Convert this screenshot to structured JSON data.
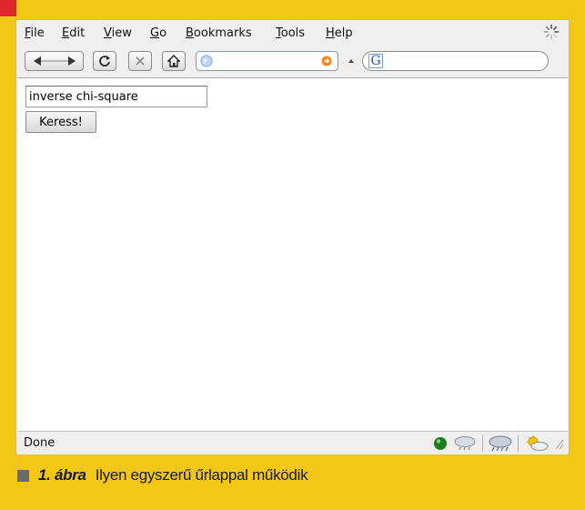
{
  "menubar": {
    "items": [
      {
        "label": "File",
        "mnemonic": "F",
        "rest": "ile"
      },
      {
        "label": "Edit",
        "mnemonic": "E",
        "rest": "dit"
      },
      {
        "label": "View",
        "mnemonic": "V",
        "rest": "iew"
      },
      {
        "label": "Go",
        "mnemonic": "G",
        "rest": "o"
      },
      {
        "label": "Bookmarks",
        "mnemonic": "B",
        "rest": "ookmarks"
      },
      {
        "label": "Tools",
        "mnemonic": "T",
        "rest": "ools"
      },
      {
        "label": "Help",
        "mnemonic": "H",
        "rest": "elp"
      }
    ]
  },
  "toolbar": {
    "icons": [
      "back-icon",
      "forward-icon",
      "reload-icon",
      "stop-icon",
      "home-icon"
    ],
    "url_value": "",
    "search_value": ""
  },
  "form": {
    "input_value": "inverse chi-square",
    "button_label": "Keress!"
  },
  "status": {
    "text": "Done",
    "icons": [
      "online-indicator-icon",
      "cloud-rain-icon",
      "thunderstorm-icon",
      "sun-cloud-icon"
    ]
  },
  "caption": {
    "label": "1. ábra",
    "text": "Ilyen egyszerű űrlappal működik"
  },
  "colors": {
    "page_background": "#f2c716",
    "corner_accent": "#e0282c",
    "caption_square": "#6a6a6a"
  }
}
